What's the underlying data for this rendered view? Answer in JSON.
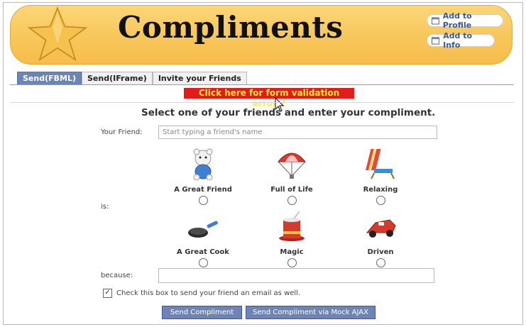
{
  "app": {
    "title": "Compliments"
  },
  "header": {
    "add_profile_label": "Add to Profile",
    "add_info_label": "Add to Info"
  },
  "tabs": [
    {
      "label": "Send(FBML)",
      "active": true
    },
    {
      "label": "Send(IFrame)",
      "active": false
    },
    {
      "label": "Invite your Friends",
      "active": false
    }
  ],
  "error_link": "Click here for form validation errors!",
  "form": {
    "heading": "Select one of your friends and enter your compliment.",
    "friend_label": "Your Friend:",
    "friend_placeholder": "Start typing a friend's name",
    "is_label": "is:",
    "because_label": "because:",
    "because_value": "",
    "options": [
      {
        "label": "A Great Friend",
        "icon": "teddy-bear-icon"
      },
      {
        "label": "Full of Life",
        "icon": "parachute-icon"
      },
      {
        "label": "Relaxing",
        "icon": "beach-chair-icon"
      },
      {
        "label": "A Great Cook",
        "icon": "frying-pan-icon"
      },
      {
        "label": "Magic",
        "icon": "magic-hat-icon"
      },
      {
        "label": "Driven",
        "icon": "race-car-icon"
      }
    ],
    "email_checkbox_label": "Check this box to send your friend an email as well.",
    "email_checked": true,
    "send_label": "Send Compliment",
    "send_ajax_label": "Send Compliment via Mock AJAX"
  },
  "colors": {
    "accent": "#6d84b4",
    "banner": "#f8c65a",
    "error_bg": "#e51a1a",
    "error_text": "#ffef3a"
  }
}
